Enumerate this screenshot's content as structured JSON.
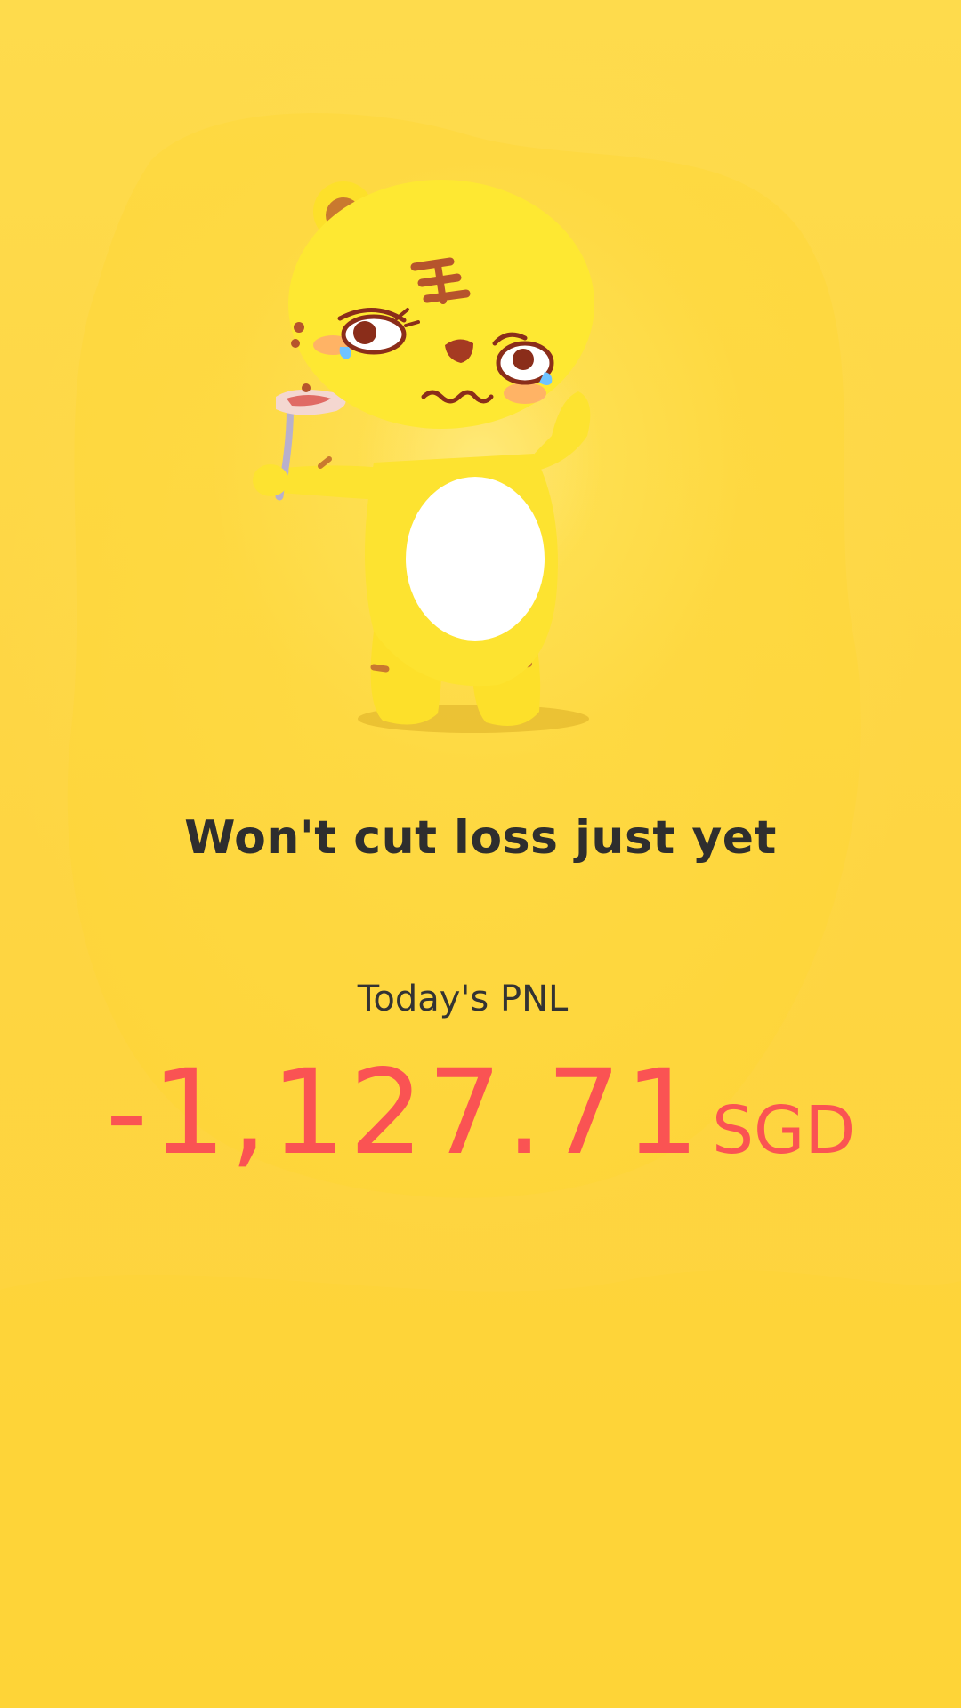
{
  "hero": {
    "mascot_icon": "crying-tiger-mascot-icon",
    "headline": "Won't cut loss just yet"
  },
  "pnl": {
    "label": "Today's PNL",
    "value": "-1,127.71",
    "currency": "SGD"
  },
  "colors": {
    "background": "#fed542",
    "headline": "#2e2e2e",
    "label": "#333333",
    "loss": "#fa5353"
  }
}
